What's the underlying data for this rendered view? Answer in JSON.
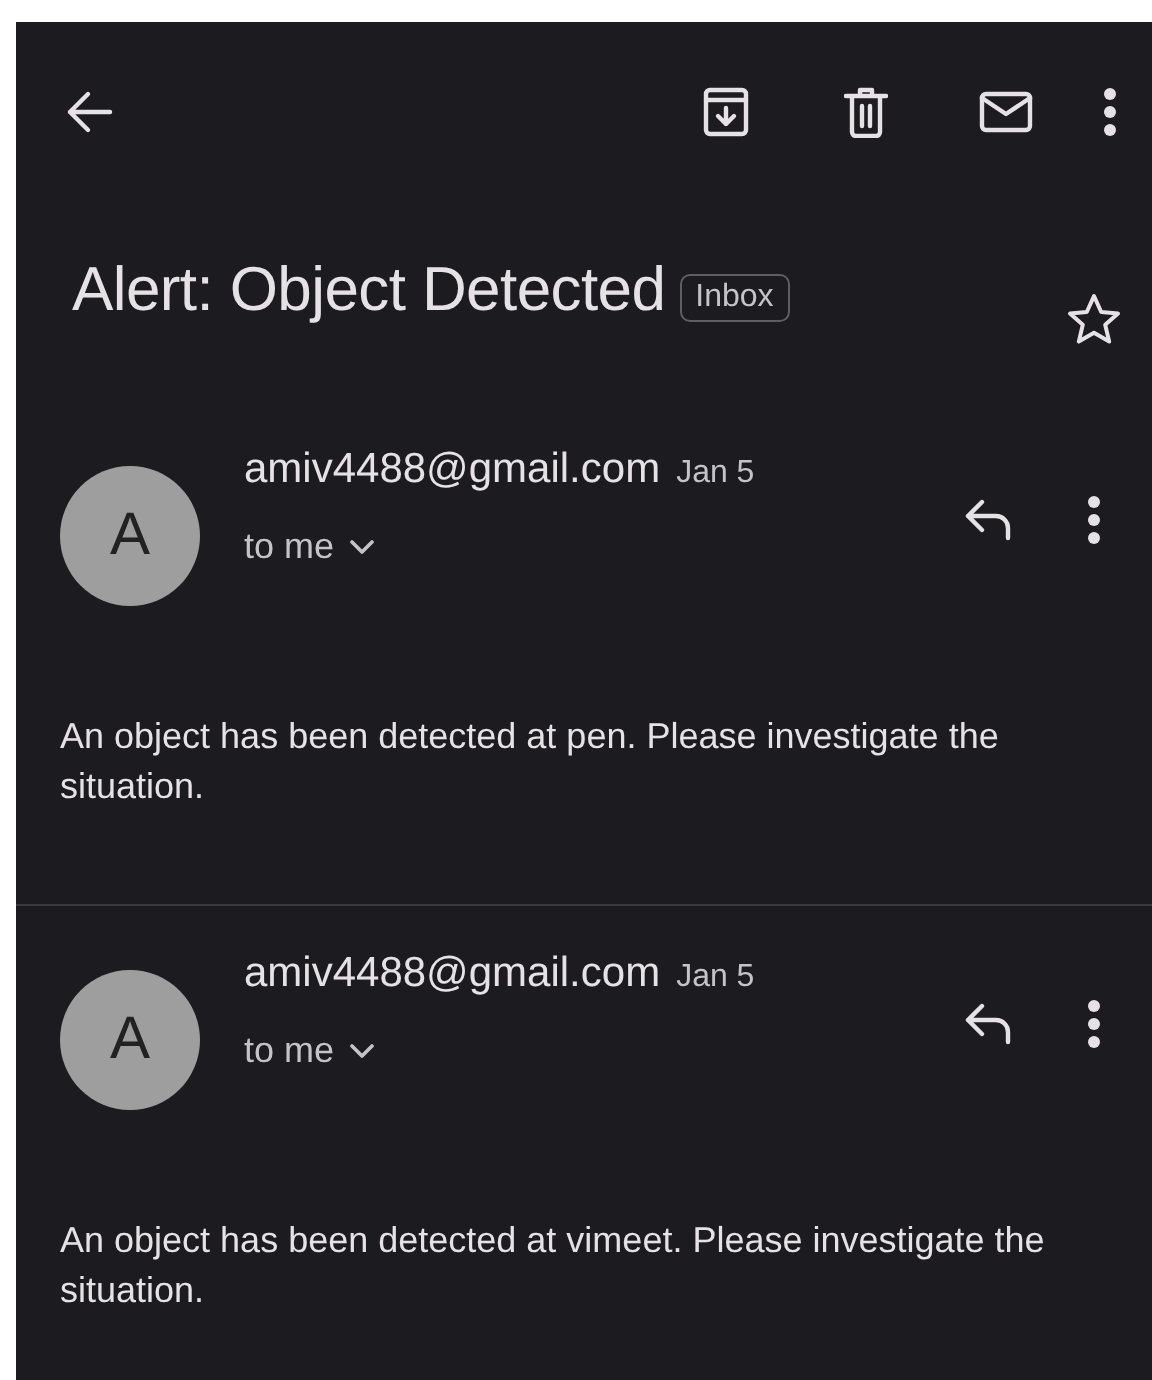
{
  "subject": "Alert: Object Detected",
  "label": "Inbox",
  "starred": false,
  "messages": [
    {
      "avatar": "A",
      "sender": "amiv4488@gmail.com",
      "date": "Jan 5",
      "recipient": "to me",
      "body": "An object has been detected at pen. Please investigate the situation."
    },
    {
      "avatar": "A",
      "sender": "amiv4488@gmail.com",
      "date": "Jan 5",
      "recipient": "to me",
      "body": "An object has been detected at vimeet. Please investigate the situation."
    }
  ]
}
